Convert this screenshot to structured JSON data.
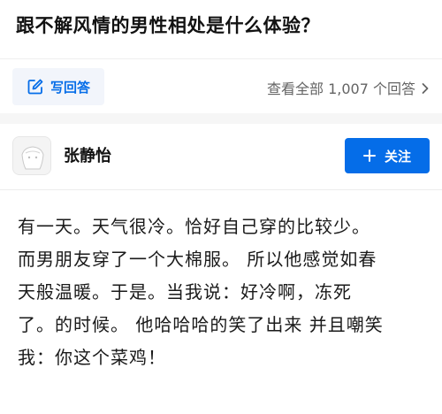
{
  "question": {
    "title": "跟不解风情的男性相处是什么体验？"
  },
  "actions": {
    "write_answer_label": "写回答",
    "write_answer_icon": "pen-square-icon",
    "view_all_label": "查看全部 1,007 个回答",
    "view_all_icon": "chevron-right-icon"
  },
  "author": {
    "name": "张静怡",
    "follow_label": "关注",
    "follow_icon": "plus-icon"
  },
  "answer": {
    "lines": [
      "有一天。天气很冷。恰好自己穿的比较少。",
      "而男朋友穿了一个大棉服。 所以他感觉如春",
      "天般温暖。于是。当我说：好冷啊，冻死",
      "了。的时候。 他哈哈哈的笑了出来 并且嘲笑",
      "我：你这个菜鸡！"
    ]
  },
  "colors": {
    "accent": "#056de8",
    "accent_bg": "#f2f5fb",
    "muted_text": "#646464",
    "gap": "#f6f6f6"
  }
}
